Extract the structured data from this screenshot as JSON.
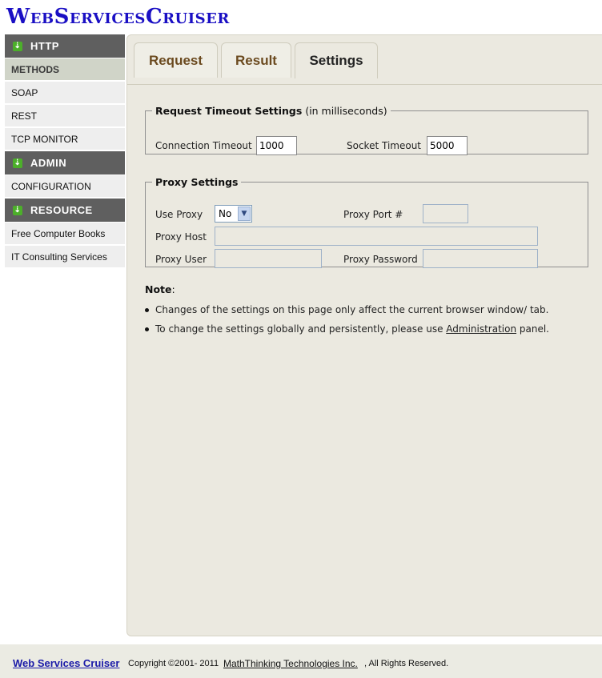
{
  "app": {
    "logo": "WebServicesCruiser"
  },
  "sidebar": {
    "sections": [
      {
        "title": "HTTP",
        "items": [
          "METHODS",
          "SOAP",
          "REST",
          "TCP MONITOR"
        ]
      },
      {
        "title": "ADMIN",
        "items": [
          "CONFIGURATION"
        ]
      },
      {
        "title": "RESOURCE",
        "items": [
          "Free Computer Books",
          "IT Consulting Services"
        ]
      }
    ],
    "active_item": "METHODS"
  },
  "tabs": [
    {
      "label": "Request"
    },
    {
      "label": "Result"
    },
    {
      "label": "Settings",
      "active": true
    }
  ],
  "timeout": {
    "legend": "Request Timeout Settings",
    "legend_note": "(in milliseconds)",
    "connection_label": "Connection Timeout",
    "connection_value": "1000",
    "socket_label": "Socket Timeout",
    "socket_value": "5000"
  },
  "proxy": {
    "legend": "Proxy Settings",
    "use_proxy_label": "Use Proxy",
    "use_proxy_value": "No",
    "port_label": "Proxy Port #",
    "host_label": "Proxy Host",
    "user_label": "Proxy User",
    "password_label": "Proxy Password"
  },
  "note": {
    "title": "Note",
    "colon": ":",
    "item1": "Changes of the settings on this page only affect the current browser window/ tab.",
    "item2_prefix": "To change the settings globally and persistently, please use ",
    "item2_link": "Administration",
    "item2_suffix": " panel."
  },
  "footer": {
    "brand": "Web Services Cruiser",
    "copyright": "Copyright ©2001- 2011",
    "company": "MathThinking Technologies Inc.",
    "rights": ", All Rights Reserved."
  },
  "colors": {
    "logo": "#1a0fc4",
    "section_header": "#5f5f5f",
    "tab_text": "#6b4a1f",
    "panel": "#ebe9e0"
  }
}
